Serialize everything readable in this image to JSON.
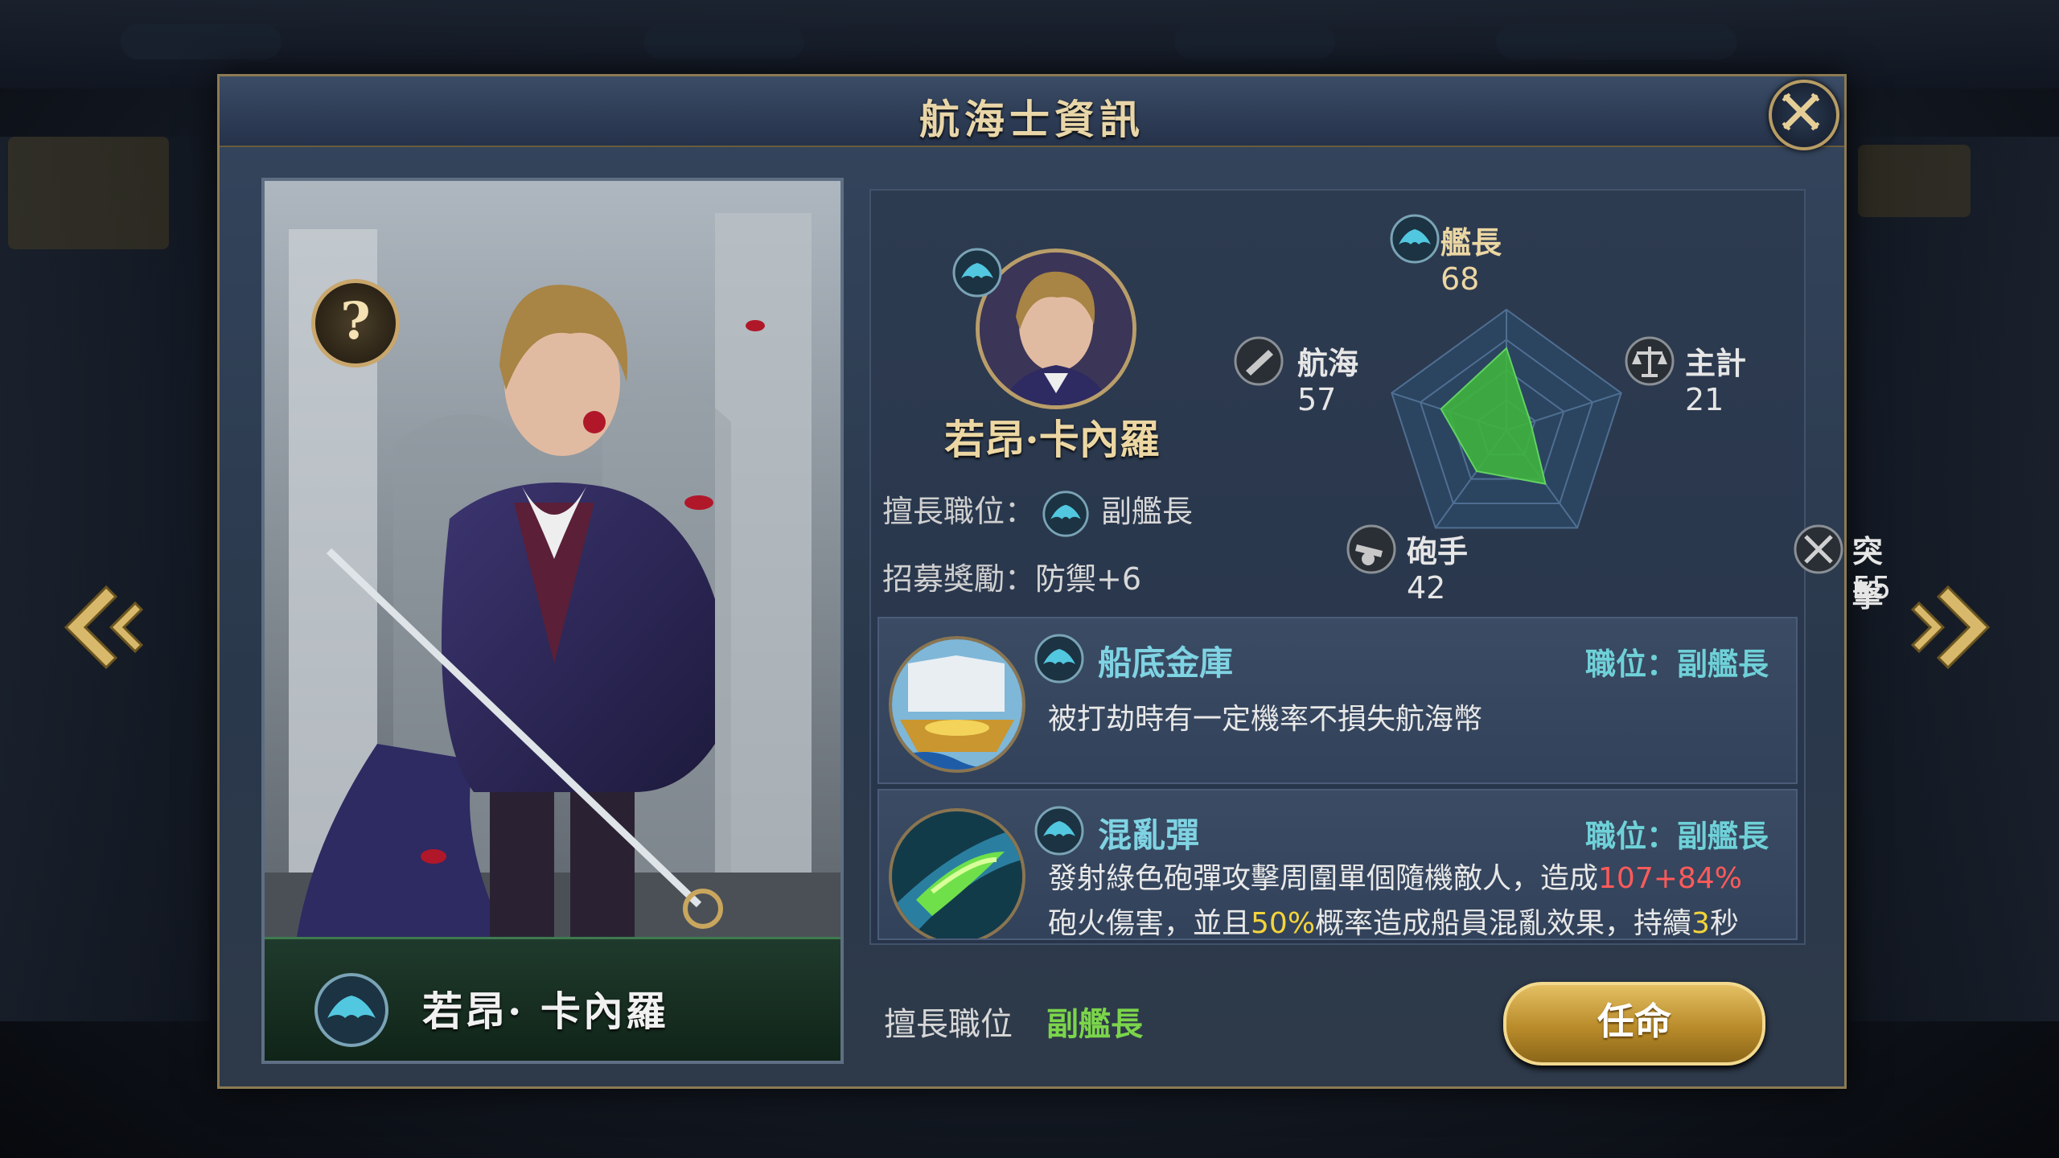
{
  "dialog": {
    "title": "航海士資訊"
  },
  "character": {
    "name": "若昂·卡內羅",
    "plate_name": "若昂· 卡內羅",
    "role_label": "擅長職位：",
    "role_value": "副艦長",
    "bonus_label": "招募獎勵：",
    "bonus_value": "防禦+6"
  },
  "stats": [
    {
      "name": "艦長",
      "value": "68"
    },
    {
      "name": "航海",
      "value": "57"
    },
    {
      "name": "主計",
      "value": "21"
    },
    {
      "name": "砲手",
      "value": "42"
    },
    {
      "name": "突擊",
      "value": "55"
    }
  ],
  "skills": [
    {
      "name": "船底金庫",
      "role": "職位：副艦長",
      "desc": "被打劫時有一定機率不損失航海幣"
    },
    {
      "name": "混亂彈",
      "role": "職位：副艦長",
      "desc_1a": "發射綠色砲彈攻擊周圍單個隨機敵人，造成",
      "desc_1b": "107+84%",
      "desc_2a": "砲火傷害，並且",
      "desc_2b": "50%",
      "desc_2c": "概率造成船員混亂效果，持續",
      "desc_2d": "3",
      "desc_2e": "秒"
    }
  ],
  "footer": {
    "role_label": "擅長職位",
    "role_value": "副艦長",
    "appoint_button": "任命"
  },
  "help_symbol": "?",
  "colors": {
    "gold": "#ecd7a3",
    "skill_name": "#7fd3e3",
    "highlight_red": "#ff5a5a",
    "highlight_yellow": "#f5d43a",
    "radar_fill": "#3fb43f"
  }
}
